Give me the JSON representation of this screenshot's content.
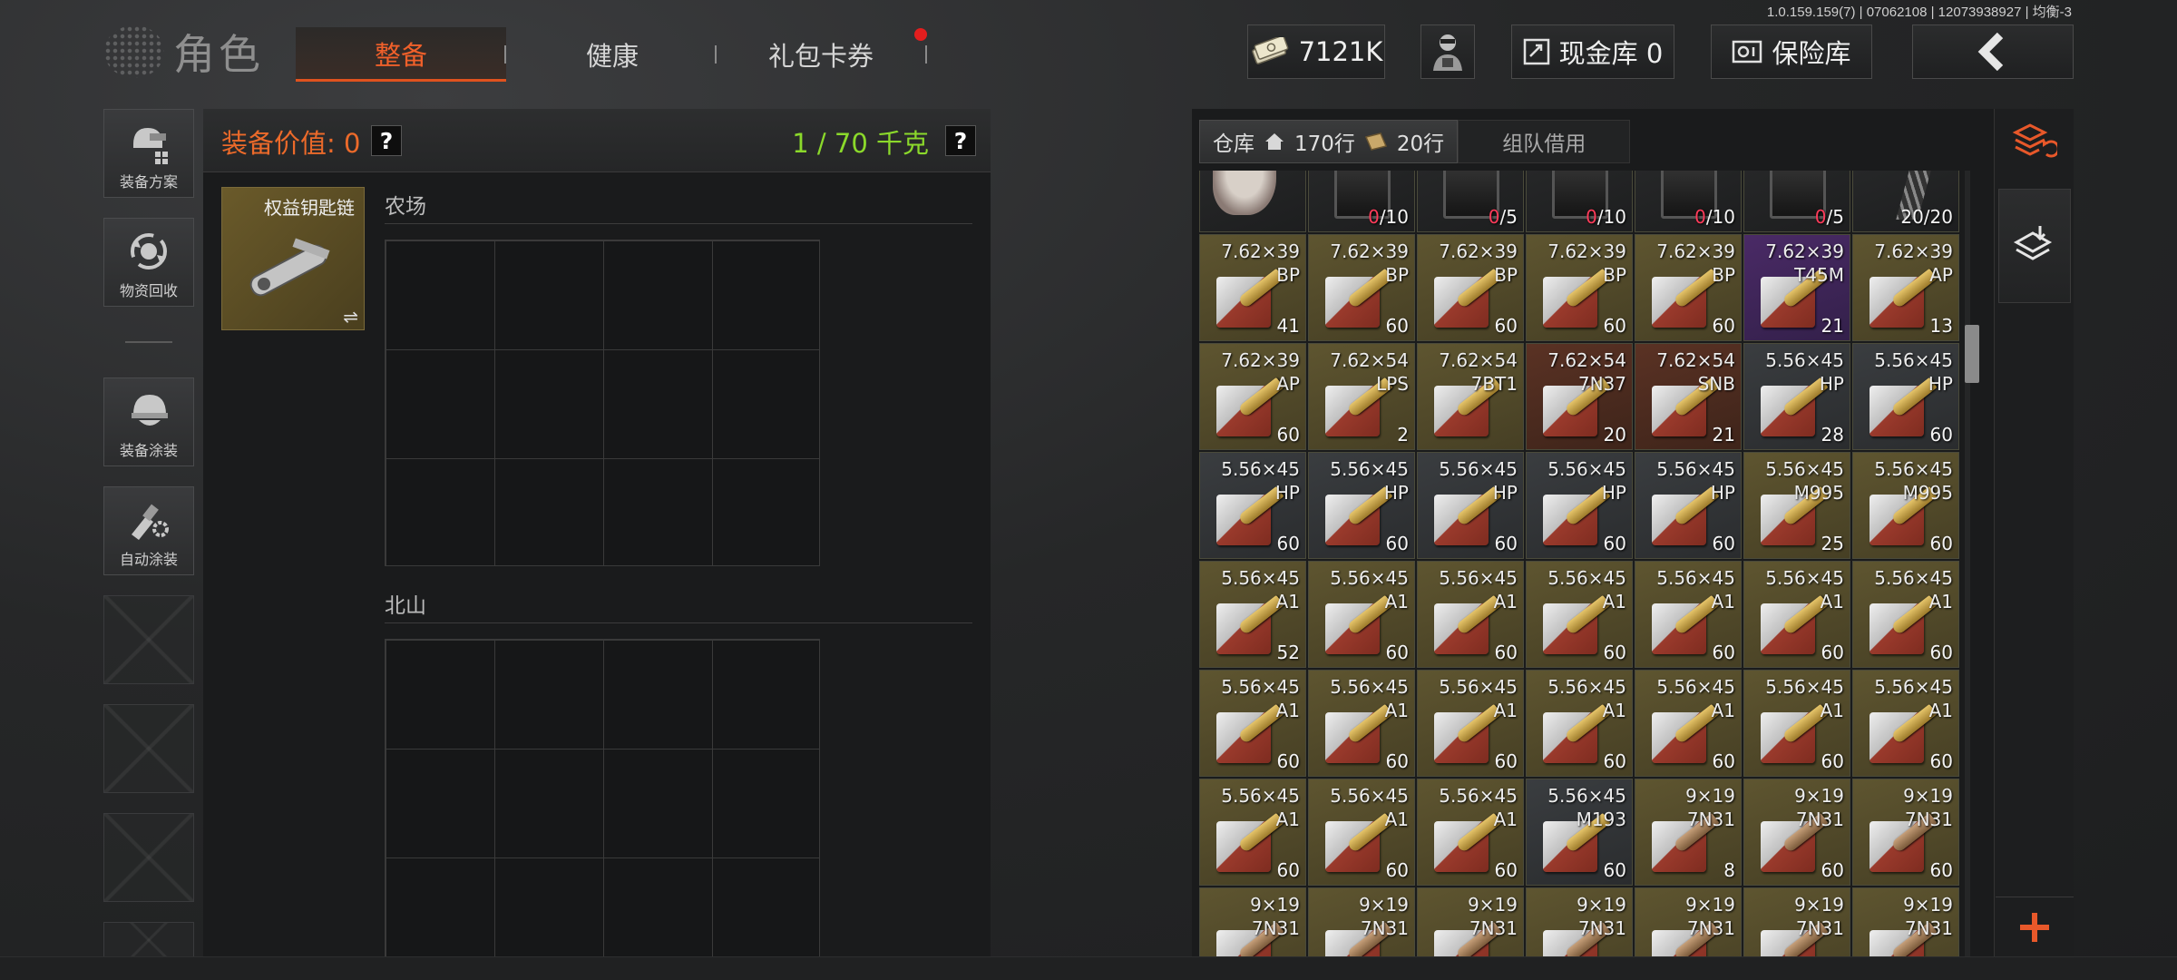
{
  "version": "1.0.159.159(7) | 07062108 | 12073938927 | 均衡-3",
  "header": {
    "title": "角色",
    "tabs": [
      {
        "label": "整备",
        "active": true
      },
      {
        "label": "健康",
        "active": false
      },
      {
        "label": "礼包卡券",
        "active": false,
        "notification": true
      }
    ],
    "money": "7121K",
    "cash_vault": "现金库 0",
    "safe": "保险库"
  },
  "sidebar": {
    "items": [
      {
        "label": "装备方案",
        "icon": "loadout-icon"
      },
      {
        "label": "物资回收",
        "icon": "recycle-icon"
      },
      {
        "label": "装备涂装",
        "icon": "helmet-paint-icon"
      },
      {
        "label": "自动涂装",
        "icon": "auto-paint-icon"
      }
    ]
  },
  "equipment": {
    "value_label": "装备价值: 0",
    "weight_label": "1 / 70 千克",
    "help": "?",
    "keychain_name": "权益钥匙链",
    "zones": [
      "农场",
      "北山"
    ]
  },
  "warehouse": {
    "tab_label": "仓库",
    "rows_total": "170行",
    "rows_extra": "20行",
    "team_tab": "组队借用",
    "top_row": [
      {
        "type": "rag",
        "count": ""
      },
      {
        "type": "case",
        "count": "0/10",
        "count_red": "0",
        "count_rest": "/10"
      },
      {
        "type": "case",
        "count": "0/5",
        "count_red": "0",
        "count_rest": "/5"
      },
      {
        "type": "case",
        "count": "0/10",
        "count_red": "0",
        "count_rest": "/10"
      },
      {
        "type": "case",
        "count": "0/10",
        "count_red": "0",
        "count_rest": "/10"
      },
      {
        "type": "case",
        "count": "0/5",
        "count_red": "0",
        "count_rest": "/5"
      },
      {
        "type": "strip",
        "count": "20/20",
        "count_red": "",
        "count_rest": "20/20"
      }
    ],
    "ammo": [
      {
        "cal": "7.62×39",
        "typ": "BP",
        "cnt": "41",
        "c": "y"
      },
      {
        "cal": "7.62×39",
        "typ": "BP",
        "cnt": "60",
        "c": "y"
      },
      {
        "cal": "7.62×39",
        "typ": "BP",
        "cnt": "60",
        "c": "y"
      },
      {
        "cal": "7.62×39",
        "typ": "BP",
        "cnt": "60",
        "c": "y"
      },
      {
        "cal": "7.62×39",
        "typ": "BP",
        "cnt": "60",
        "c": "y"
      },
      {
        "cal": "7.62×39",
        "typ": "T45M",
        "cnt": "21",
        "c": "p"
      },
      {
        "cal": "7.62×39",
        "typ": "AP",
        "cnt": "13",
        "c": "y"
      },
      {
        "cal": "7.62×39",
        "typ": "AP",
        "cnt": "60",
        "c": "y"
      },
      {
        "cal": "7.62×54",
        "typ": "LPS",
        "cnt": "2",
        "c": "y"
      },
      {
        "cal": "7.62×54",
        "typ": "7BT1",
        "cnt": "",
        "c": "y"
      },
      {
        "cal": "7.62×54",
        "typ": "7N37",
        "cnt": "20",
        "c": "r"
      },
      {
        "cal": "7.62×54",
        "typ": "SNB",
        "cnt": "21",
        "c": "r"
      },
      {
        "cal": "5.56×45",
        "typ": "HP",
        "cnt": "28",
        "c": "g"
      },
      {
        "cal": "5.56×45",
        "typ": "HP",
        "cnt": "60",
        "c": "g"
      },
      {
        "cal": "5.56×45",
        "typ": "HP",
        "cnt": "60",
        "c": "g"
      },
      {
        "cal": "5.56×45",
        "typ": "HP",
        "cnt": "60",
        "c": "g"
      },
      {
        "cal": "5.56×45",
        "typ": "HP",
        "cnt": "60",
        "c": "g"
      },
      {
        "cal": "5.56×45",
        "typ": "HP",
        "cnt": "60",
        "c": "g"
      },
      {
        "cal": "5.56×45",
        "typ": "HP",
        "cnt": "60",
        "c": "g"
      },
      {
        "cal": "5.56×45",
        "typ": "M995",
        "cnt": "25",
        "c": "y"
      },
      {
        "cal": "5.56×45",
        "typ": "M995",
        "cnt": "60",
        "c": "y"
      },
      {
        "cal": "5.56×45",
        "typ": "A1",
        "cnt": "52",
        "c": "y"
      },
      {
        "cal": "5.56×45",
        "typ": "A1",
        "cnt": "60",
        "c": "y"
      },
      {
        "cal": "5.56×45",
        "typ": "A1",
        "cnt": "60",
        "c": "y"
      },
      {
        "cal": "5.56×45",
        "typ": "A1",
        "cnt": "60",
        "c": "y"
      },
      {
        "cal": "5.56×45",
        "typ": "A1",
        "cnt": "60",
        "c": "y"
      },
      {
        "cal": "5.56×45",
        "typ": "A1",
        "cnt": "60",
        "c": "y"
      },
      {
        "cal": "5.56×45",
        "typ": "A1",
        "cnt": "60",
        "c": "y"
      },
      {
        "cal": "5.56×45",
        "typ": "A1",
        "cnt": "60",
        "c": "y"
      },
      {
        "cal": "5.56×45",
        "typ": "A1",
        "cnt": "60",
        "c": "y"
      },
      {
        "cal": "5.56×45",
        "typ": "A1",
        "cnt": "60",
        "c": "y"
      },
      {
        "cal": "5.56×45",
        "typ": "A1",
        "cnt": "60",
        "c": "y"
      },
      {
        "cal": "5.56×45",
        "typ": "A1",
        "cnt": "60",
        "c": "y"
      },
      {
        "cal": "5.56×45",
        "typ": "A1",
        "cnt": "60",
        "c": "y"
      },
      {
        "cal": "5.56×45",
        "typ": "A1",
        "cnt": "60",
        "c": "y"
      },
      {
        "cal": "5.56×45",
        "typ": "A1",
        "cnt": "60",
        "c": "y"
      },
      {
        "cal": "5.56×45",
        "typ": "A1",
        "cnt": "60",
        "c": "y"
      },
      {
        "cal": "5.56×45",
        "typ": "A1",
        "cnt": "60",
        "c": "y"
      },
      {
        "cal": "5.56×45",
        "typ": "M193",
        "cnt": "60",
        "c": "g"
      },
      {
        "cal": "9×19",
        "typ": "7N31",
        "cnt": "8",
        "c": "y"
      },
      {
        "cal": "9×19",
        "typ": "7N31",
        "cnt": "60",
        "c": "y"
      },
      {
        "cal": "9×19",
        "typ": "7N31",
        "cnt": "60",
        "c": "y"
      },
      {
        "cal": "9×19",
        "typ": "7N31",
        "cnt": "",
        "c": "y"
      },
      {
        "cal": "9×19",
        "typ": "7N31",
        "cnt": "",
        "c": "y"
      },
      {
        "cal": "9×19",
        "typ": "7N31",
        "cnt": "",
        "c": "y"
      },
      {
        "cal": "9×19",
        "typ": "7N31",
        "cnt": "",
        "c": "y"
      },
      {
        "cal": "9×19",
        "typ": "7N31",
        "cnt": "",
        "c": "y"
      },
      {
        "cal": "9×19",
        "typ": "7N31",
        "cnt": "",
        "c": "y"
      },
      {
        "cal": "9×19",
        "typ": "7N31",
        "cnt": "",
        "c": "y"
      }
    ]
  },
  "colors": {
    "accent": "#e0521e",
    "weight_green": "#8bd92b",
    "count_red": "#ff3b5a"
  }
}
